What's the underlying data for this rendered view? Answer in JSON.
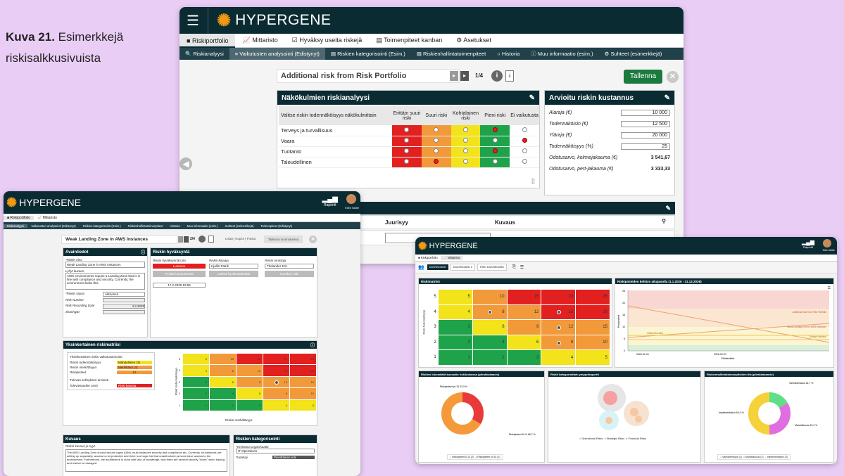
{
  "caption": {
    "bold": "Kuva 21.",
    "text_line1": "Esimerkkejä",
    "text_line2": "riskisalkkusivuista"
  },
  "brand": "HYPERGENE",
  "colors": {
    "header": "#0b2b33",
    "red": "#e32020",
    "orange": "#f29a3a",
    "yellow": "#f2e31a",
    "green": "#1fa34a",
    "gray": "#d9d9d9",
    "accent": "#f29a12"
  },
  "main": {
    "tabs": [
      "Riskiportfolio",
      "Mittaristo",
      "Hyväksy useita riskejä",
      "Toimenpiteet kanban",
      "Asetukset"
    ],
    "subtabs": [
      "Riskianalyysi",
      "Vaikutusten analysointi (Edistynyt)",
      "Riskien kategorisointi (Esim.)",
      "Riskienhallintatoimenpiteet",
      "Historia",
      "Muu informaatio (esim.)",
      "Suhteet (esimerkkejä)"
    ],
    "risk_title": "Additional risk from Risk Portfolio",
    "pager": "1/4",
    "save": "Tallenna",
    "analysis": {
      "title": "Näkökulmien riskianalyysi",
      "row_header": "Valitse riskin todennäköisyys näkökulmittain",
      "cols": [
        "Erittäin suuri riski",
        "Suuri riski",
        "Kohtalainen riski",
        "Pieni riski",
        "Ei vaikutusta"
      ],
      "rows": [
        {
          "label": "Terveys ja turvallisuus",
          "sel": 3
        },
        {
          "label": "Vaara",
          "sel": 4
        },
        {
          "label": "Tuotanto",
          "sel": 3
        },
        {
          "label": "Taloudellinen",
          "sel": 1
        }
      ]
    },
    "cost": {
      "title": "Arvioitu riskin kustannus",
      "rows": [
        {
          "label": "Alaraja (€)",
          "value": "10 000"
        },
        {
          "label": "Todennäköisin (€)",
          "value": "12 500"
        },
        {
          "label": "Yläraja (€)",
          "value": "20 000"
        },
        {
          "label": "Todennäköisyys (%)",
          "value": "25"
        }
      ],
      "results": [
        {
          "label": "Odotusarvo, kolmiojakauma (€)",
          "value": "3 541,67"
        },
        {
          "label": "Odotusarvo, pert-jakauma (€)",
          "value": "3 333,33"
        }
      ]
    },
    "bottom": {
      "col_juurisyy": "Juurisyy",
      "col_kuvaus": "Kuvaus"
    }
  },
  "left": {
    "header_right": [
      "Raportit",
      "Ellen Malte"
    ],
    "tabs": [
      "Riskiportfolio",
      "Mittaristo"
    ],
    "subtabs": [
      "Riskianalyysi",
      "Vaikutusten analysointi (Edistynyt)",
      "Riskien kategorisointi (Esim.)",
      "Riskienhallintatoimenpiteet",
      "Historia",
      "Muu informaatio (esim.)",
      "Suhteet (esimerkkejä)",
      "Toimenpiteet (Edistynyt)"
    ],
    "risk_title": "Weak Landing Zone in AWS Instances",
    "pager": "2/4",
    "links": "Lisää | Kopioi | Poista",
    "save": "Tallenna luonnoksena",
    "basic": {
      "title": "Avaintiedot",
      "name_label": "*Riskin nimi",
      "name_value": "Weak Landing Zone in AWS Instances",
      "desc_label": "Lyhyt kuvaus",
      "desc_value": "AWS environments require a Landing Zone that is in line with compliance and security. Currently, the environment lacks this.",
      "status_label": "*Riskin status",
      "status_value": "Aktiivinen",
      "number_label": "Risk Number",
      "date_label": "Risk Recording Date",
      "date_value": "4.3.2025",
      "sharing_label": "SharingID"
    },
    "approval": {
      "title": "Riskin hyväksyntä",
      "c1_label": "Riskin hyväksynnän tila",
      "c1_badge": "Luonnos",
      "c1_btn": "Pyydä luonnoksesta",
      "c1_date": "17.2.2026 15:55",
      "c2_label": "Riskin kirjaaja",
      "c2_value": "Hjallin Patrik",
      "c2_btn": "Lähetä hyväksyttäväksi",
      "c3_label": "Riskin omistaja",
      "c3_value": "Thelander Eric",
      "c3_btn": "Hyväksy riski"
    },
    "matrix": {
      "title": "Yksinkertainen riskimatriisi",
      "assess_title": "Yksinkertainen riskin vaikutusarviointi",
      "prob_label": "Riskin todennäköisyys",
      "prob_value": "Mahdollinen (3)",
      "impact_label": "Riskin merkittävyys",
      "impact_value": "Merkittävä (4)",
      "points_label": "Riskipisteet",
      "points_value": "12",
      "future_title": "Tulevan kehityksen arviointi",
      "future_label": "Tulevaisuuden arvio",
      "future_value": "Riski kasvaa",
      "ylabel": "Riskin todennäköisyys",
      "xlabel": "Riskin merkittävyys",
      "rows": [
        {
          "y": "5",
          "vals": [
            "5",
            "10",
            "15",
            "20",
            "25"
          ]
        },
        {
          "y": "4",
          "vals": [
            "4",
            "8",
            "12",
            "16",
            "20"
          ]
        },
        {
          "y": "3",
          "vals": [
            "3",
            "6",
            "9",
            "12",
            "15"
          ]
        },
        {
          "y": "2",
          "vals": [
            "2",
            "4",
            "6",
            "8",
            "10"
          ]
        },
        {
          "y": "1",
          "vals": [
            "1",
            "2",
            "3",
            "4",
            "5"
          ]
        }
      ],
      "xticks": [
        "1",
        "2",
        "3",
        "4",
        "5"
      ]
    },
    "desc": {
      "title": "Kuvaus",
      "label": "Riskin kuvaus ja syyt",
      "text": "The AWS Landing Zone should secure logins (IAM), multi-instances security and compliance etc. Currently, all instances are setting up separately, access is not protected and there is a huge risk that unauthorized persons have access to the environment. Furthermore, the architecture is done with lack of knowledge, why there are several security \"holes\" when backup and restore is managed."
    },
    "cat": {
      "title": "Riskien kategorisointi",
      "org_label": "*Omistava organisaatio",
      "org_value": "IT-Operations",
      "tuote_label": "Tuotelaji",
      "tuote_value": "Pienittäinen erä"
    }
  },
  "dash": {
    "header_right": [
      "Raportit",
      "Ellen Malte"
    ],
    "tabs": [
      "Riskiportfolio",
      "Mittaristo"
    ],
    "subtabs": [
      "DASHBOARD",
      "DASHBOARD 2",
      "RISK DASHBOARD"
    ],
    "matrix_title": "Riskimatriisi",
    "ylabel": "Riskin todennäköisyys",
    "rows": [
      {
        "y": "5",
        "vals": [
          "5",
          "10",
          "15",
          "20",
          "25"
        ]
      },
      {
        "y": "4",
        "vals": [
          "4",
          "8",
          "12",
          "16",
          "20"
        ]
      },
      {
        "y": "3",
        "vals": [
          "3",
          "6",
          "9",
          "12",
          "15"
        ]
      },
      {
        "y": "2",
        "vals": [
          "2",
          "4",
          "6",
          "8",
          "10"
        ]
      },
      {
        "y": "1",
        "vals": [
          "1",
          "2",
          "3",
          "4",
          "5"
        ]
      }
    ],
    "trend_title": "Riskipisteiden kehitys aikajasolla (1.1.2026 - 31.12.2026)",
    "trend_ylabel": "Riskipisteet",
    "trend_xlabel": "Päivämäärä",
    "trend_yticks": [
      "25",
      "20",
      "15",
      "10",
      "5",
      "0"
    ],
    "trend_xticks": [
      "2026-01-01",
      "2026-02-01"
    ],
    "trend_labels": [
      "Additional risk from Risk Portfolio",
      "Weak Landing Zone in AWS instances",
      "Inflation/lending",
      "Delayed delivery"
    ],
    "donut1": {
      "title": "Riskien lukumäärä kussakin riskiluokassa (piirakkakaavio)",
      "lab_a": "Riskipisteet yli 15\n33,3 %",
      "lab_b": "Riskipisteet 6-14\n66,7 %",
      "legend": [
        "Riskipisteet 6-14 (2)",
        "Riskipisteet yli 15 (1)"
      ]
    },
    "bubble": {
      "title": "Riskit kategorioittain ympyräraportti",
      "legend": [
        "Operational Risks",
        "Strategic Risks",
        "Financial Risks"
      ]
    },
    "donut2": {
      "title": "Riskienhallintatoimenpiteiden tila (piirakkakaavio)",
      "lab_a": "Valmis/testaus\n16,7 %",
      "lab_b": "Implementation\n50,0 %",
      "lab_c": "Mahdollisuus\n33,3 %",
      "legend": [
        "Valmis/testaus (1)",
        "Mahdollisuus (2)",
        "Implementation (3)"
      ]
    }
  }
}
